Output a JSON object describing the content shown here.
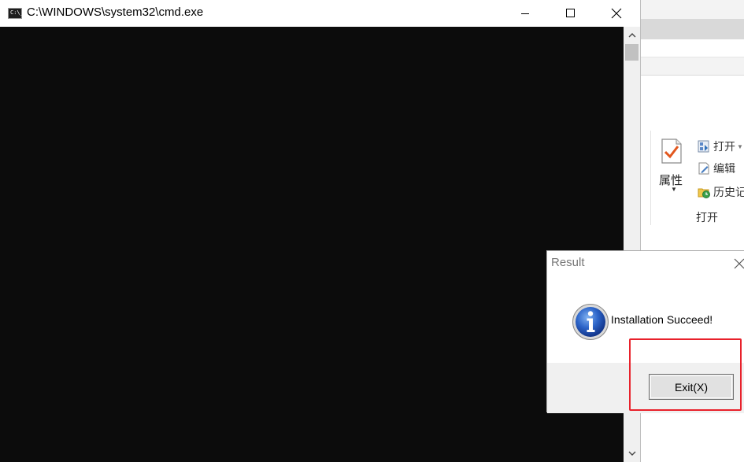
{
  "cmd_window": {
    "title": "C:\\WINDOWS\\system32\\cmd.exe",
    "icon_text": "C:\\_",
    "console_text": "",
    "controls": {
      "minimize": "minimize-icon",
      "maximize": "maximize-icon",
      "close": "close-icon"
    }
  },
  "explorer_window": {
    "ribbon": {
      "properties_label": "属性",
      "items": [
        {
          "icon": "open-icon",
          "label": "打开"
        },
        {
          "icon": "edit-icon",
          "label": "编辑"
        },
        {
          "icon": "history-icon",
          "label": "历史记"
        }
      ],
      "group_label": "打开"
    }
  },
  "dialog": {
    "title": "Result",
    "icon": "info-icon",
    "message": "Installation Succeed!",
    "button_label": "Exit(X)"
  },
  "colors": {
    "console_bg": "#0c0c0c",
    "highlight": "#e8212b",
    "dialog_footer": "#f0f0f0"
  }
}
